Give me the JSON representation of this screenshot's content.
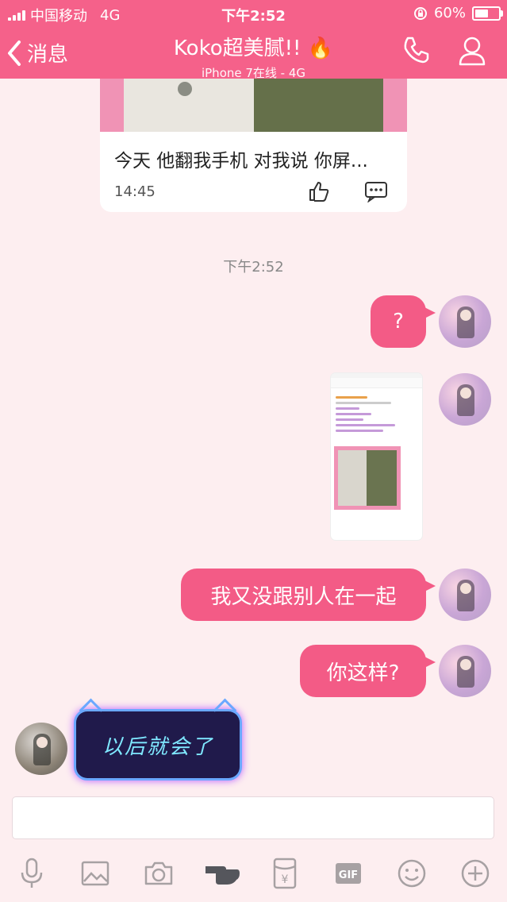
{
  "status_bar": {
    "carrier": "中国移动",
    "network": "4G",
    "time": "下午2:52",
    "battery": "60%",
    "battery_level": 0.6
  },
  "header": {
    "back_label": "消息",
    "title": "Koko超美腻!! 🔥",
    "subtitle": "iPhone 7在线 - 4G"
  },
  "post_card": {
    "text": "今天 他翻我手机 对我说 你屏...",
    "time": "14:45"
  },
  "chat": {
    "timestamp": "下午2:52",
    "messages": [
      {
        "from": "me",
        "text": "?"
      },
      {
        "from": "me",
        "type": "image"
      },
      {
        "from": "me",
        "text": "我又没跟别人在一起"
      },
      {
        "from": "me",
        "text": "你这样?"
      },
      {
        "from": "other",
        "type": "sticker",
        "text": "以后就会了"
      }
    ]
  },
  "input": {
    "placeholder": ""
  },
  "toolbar": {
    "icons": [
      "mic-icon",
      "image-icon",
      "camera-icon",
      "poke-icon",
      "red-packet-icon",
      "gif-icon",
      "emoji-icon",
      "plus-icon"
    ]
  },
  "colors": {
    "accent": "#f5618a",
    "bubble": "#f35b86",
    "background": "#fdeef0"
  }
}
